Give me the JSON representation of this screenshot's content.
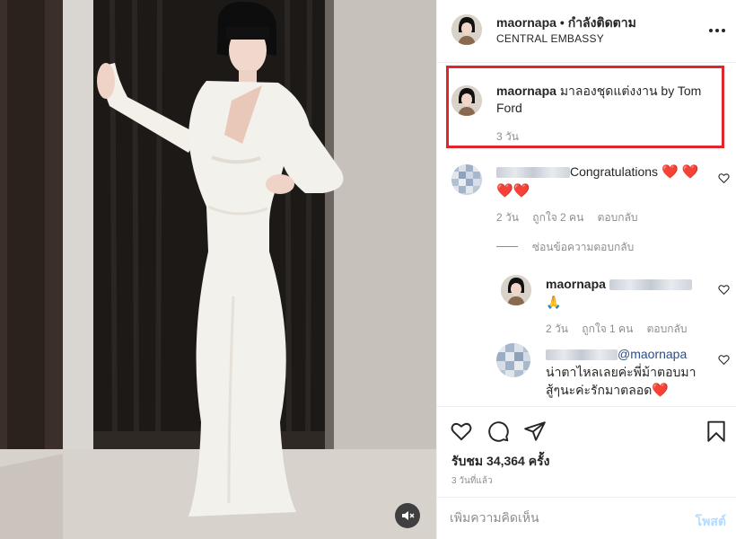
{
  "colors": {
    "accent_red": "#e0252d",
    "link": "#2b4e87",
    "muted": "#8e8e8e",
    "post_disabled": "#b3dbff"
  },
  "photo": {
    "mute_icon": "speaker-muted-icon"
  },
  "header": {
    "username": "maornapa",
    "separator": "•",
    "follow_status": "กำลังติดตาม",
    "location": "CENTRAL EMBASSY",
    "more_icon": "more-dots-icon"
  },
  "caption": {
    "username": "maornapa",
    "text": "มาลองชุดแต่งงาน by Tom Ford",
    "time": "3 วัน"
  },
  "comments": [
    {
      "text": "Congratulations",
      "hearts": "❤️ ❤️",
      "hearts2": "❤️❤️",
      "time": "2 วัน",
      "likes": "ถูกใจ 2 คน",
      "reply": "ตอบกลับ"
    }
  ],
  "hide_replies": "ซ่อนข้อความตอบกลับ",
  "reply": {
    "username": "maornapa",
    "emoji": "🙏",
    "time": "2 วัน",
    "likes": "ถูกใจ 1 คน",
    "reply": "ตอบกลับ"
  },
  "comment3": {
    "mention": "@maornapa",
    "text1": "น่าตาไหลเลยค่ะพี่ม้าตอบมา",
    "text2": "สู้ๆนะค่ะรักมาตลอด",
    "heart": "❤️"
  },
  "actions": {
    "icons": [
      "heart-icon",
      "comment-icon",
      "share-icon",
      "bookmark-icon"
    ],
    "likes": "รับชม 34,364 ครั้ง",
    "ago": "3 วันที่แล้ว"
  },
  "comment_box": {
    "placeholder": "เพิ่มความคิดเห็น",
    "post_label": "โพสต์"
  }
}
